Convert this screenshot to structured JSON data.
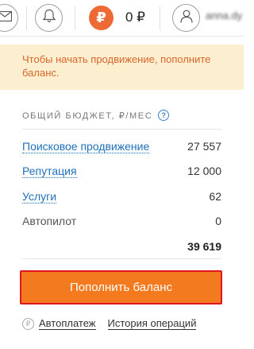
{
  "topbar": {
    "mail_icon": "envelope-icon",
    "bell_icon": "bell-icon",
    "ruble_icon": "ruble-icon",
    "ruble_glyph": "₽",
    "balance": "0 ₽",
    "user_icon": "user-icon",
    "username": "anna.dy"
  },
  "notice": {
    "text": "Чтобы начать продвижение, пополните баланс."
  },
  "budget": {
    "title": "ОБЩИЙ БЮДЖЕТ, ₽/МЕС",
    "help_glyph": "?",
    "rows": [
      {
        "label": "Поисковое продвижение",
        "value": "27 557"
      },
      {
        "label": "Репутация",
        "value": "12 000"
      },
      {
        "label": "Услуги",
        "value": "62"
      },
      {
        "label": "Автопилот",
        "value": "0"
      }
    ],
    "total": "39 619"
  },
  "actions": {
    "topup_label": "Пополнить баланс",
    "autopay_glyph": "₽",
    "autopay_label": "Автоплатеж",
    "history_label": "История операций"
  },
  "colors": {
    "accent_orange": "#f37a1f",
    "button_border": "#e0141c",
    "ruble_badge": "#ee6a35",
    "notice_bg": "#fbefcf",
    "notice_text": "#d9652c",
    "link_blue": "#1f6fb9"
  }
}
